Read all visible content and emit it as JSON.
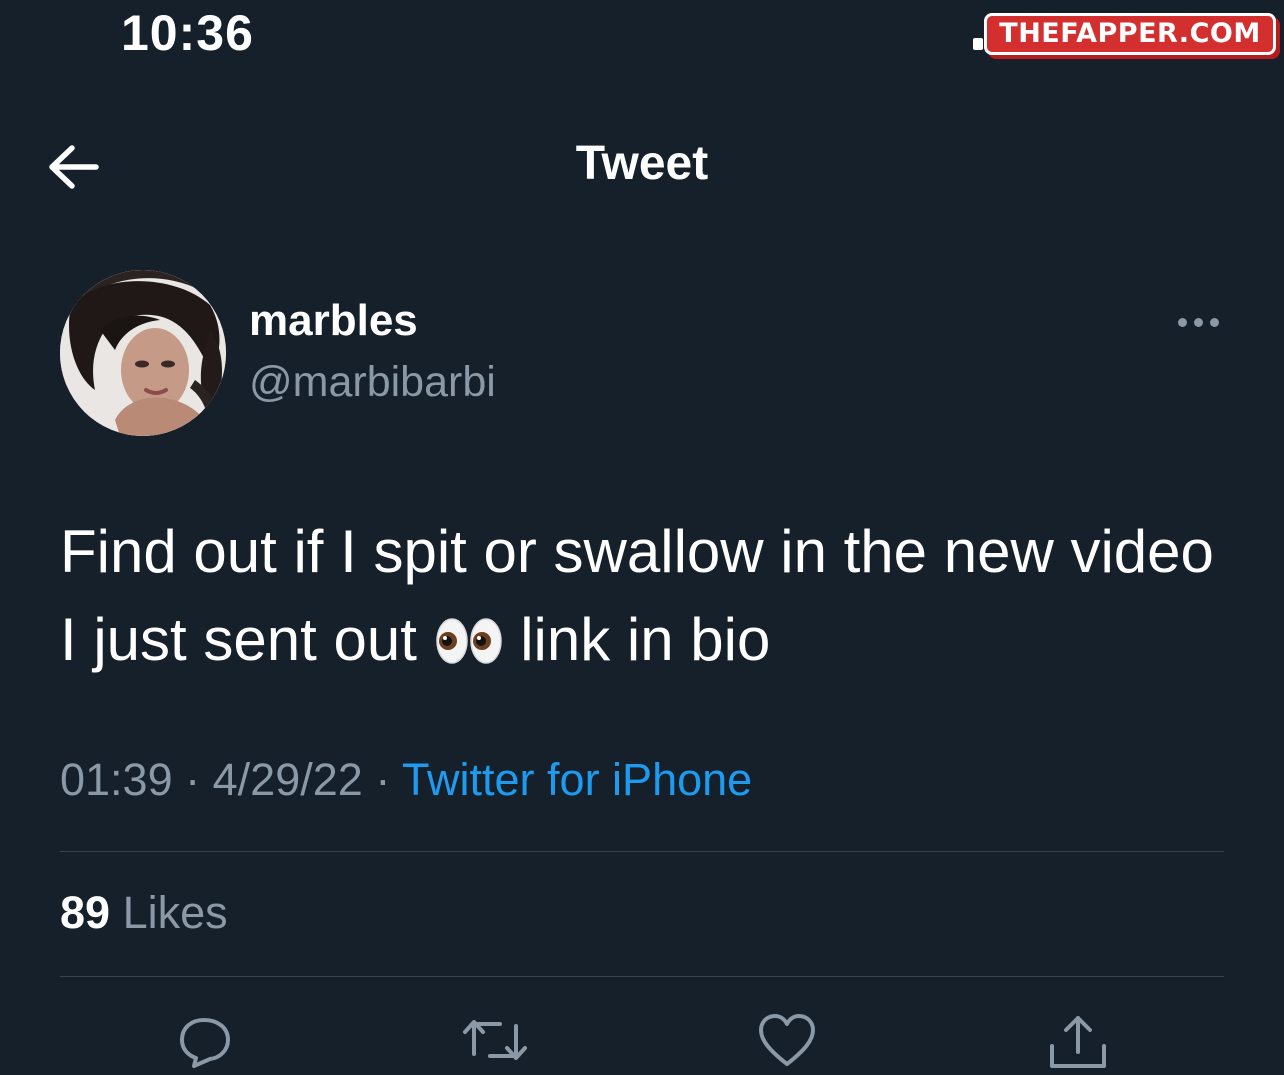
{
  "status_bar": {
    "time": "10:36"
  },
  "watermark": {
    "text": "THEFAPPER.COM"
  },
  "header": {
    "title": "Tweet",
    "back_icon": "arrow-left-icon"
  },
  "tweet": {
    "author": {
      "display_name": "marbles",
      "handle": "@marbibarbi"
    },
    "more_icon": "more-dots-icon",
    "text_part1": "Find out if I spit or swallow in the new video I just sent out",
    "emoji_icon": "eyes-emoji",
    "text_part2": "link in bio",
    "time": "01:39",
    "separator": "·",
    "date": "4/29/22",
    "source": "Twitter for iPhone",
    "likes_count": "89",
    "likes_label": "Likes"
  },
  "actions": [
    {
      "icon": "reply-icon"
    },
    {
      "icon": "retweet-icon"
    },
    {
      "icon": "like-icon"
    },
    {
      "icon": "share-icon"
    }
  ],
  "colors": {
    "background": "#15202b",
    "text_primary": "#ffffff",
    "text_secondary": "#8b98a5",
    "link": "#1d9bf0",
    "divider": "#38444d",
    "watermark": "#d32f2f"
  }
}
